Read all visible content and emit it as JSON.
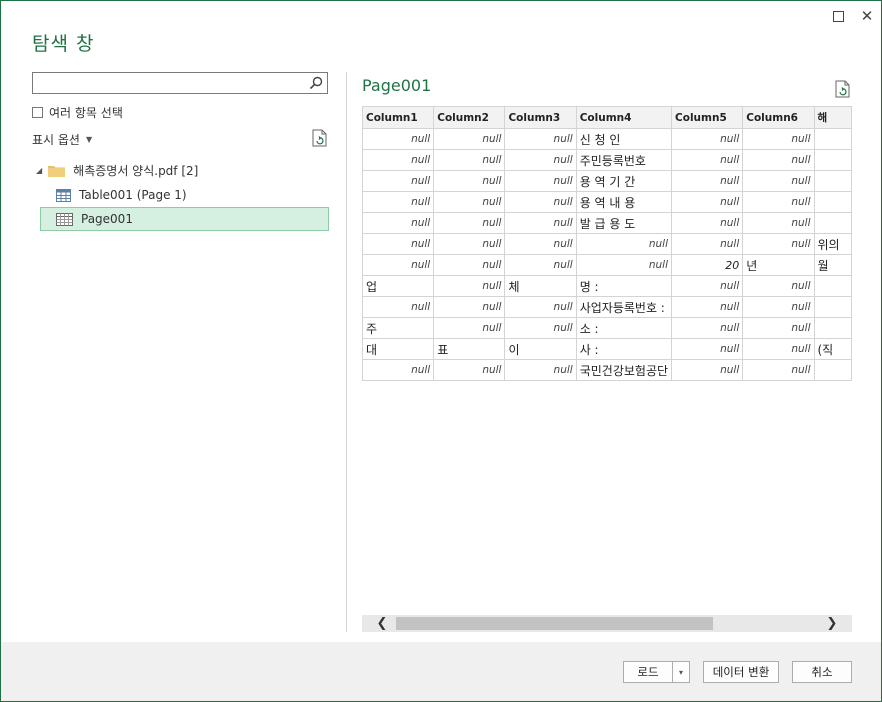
{
  "window": {
    "title": "탐색 창",
    "maximize_glyph": "",
    "close_glyph": "✕"
  },
  "left": {
    "search": {
      "value": "",
      "placeholder": ""
    },
    "multi_select_label": "여러 항목 선택",
    "display_options_label": "표시 옵션",
    "tree": {
      "folder": {
        "label": "해촉증명서 양식.pdf [2]"
      },
      "items": [
        {
          "label": "Table001 (Page 1)",
          "icon": "table-icon"
        },
        {
          "label": "Page001",
          "icon": "page-icon",
          "selected": true
        }
      ]
    }
  },
  "preview": {
    "title": "Page001",
    "columns": [
      "Column1",
      "Column2",
      "Column3",
      "Column4",
      "Column5",
      "Column6",
      "해"
    ],
    "rows": [
      [
        "null",
        "null",
        "null",
        "신 청 인",
        "null",
        "null",
        ""
      ],
      [
        "null",
        "null",
        "null",
        "주민등록번호",
        "null",
        "null",
        ""
      ],
      [
        "null",
        "null",
        "null",
        "용 역 기 간",
        "null",
        "null",
        ""
      ],
      [
        "null",
        "null",
        "null",
        "용 역 내 용",
        "null",
        "null",
        ""
      ],
      [
        "null",
        "null",
        "null",
        "발 급 용 도",
        "null",
        "null",
        ""
      ],
      [
        "null",
        "null",
        "null",
        "null",
        "null",
        "null",
        "위의"
      ],
      [
        "null",
        "null",
        "null",
        "null",
        "20",
        "년",
        "월"
      ],
      [
        "업",
        "null",
        "체",
        "명 :",
        "null",
        "null",
        ""
      ],
      [
        "null",
        "null",
        "null",
        "사업자등록번호 :",
        "null",
        "null",
        ""
      ],
      [
        "주",
        "null",
        "null",
        "소 :",
        "null",
        "null",
        ""
      ],
      [
        "대",
        "표",
        "이",
        "사 :",
        "null",
        "null",
        "(직"
      ],
      [
        "null",
        "null",
        "null",
        "국민건강보험공단",
        "null",
        "null",
        ""
      ]
    ]
  },
  "scrollbar": {
    "left_arrow": "❮",
    "right_arrow": "❯"
  },
  "footer": {
    "load_label": "로드",
    "load_dropdown": "▾",
    "transform_label": "데이터 변환",
    "cancel_label": "취소"
  },
  "colors": {
    "accent": "#217346",
    "selected_bg": "#d5efe0"
  }
}
